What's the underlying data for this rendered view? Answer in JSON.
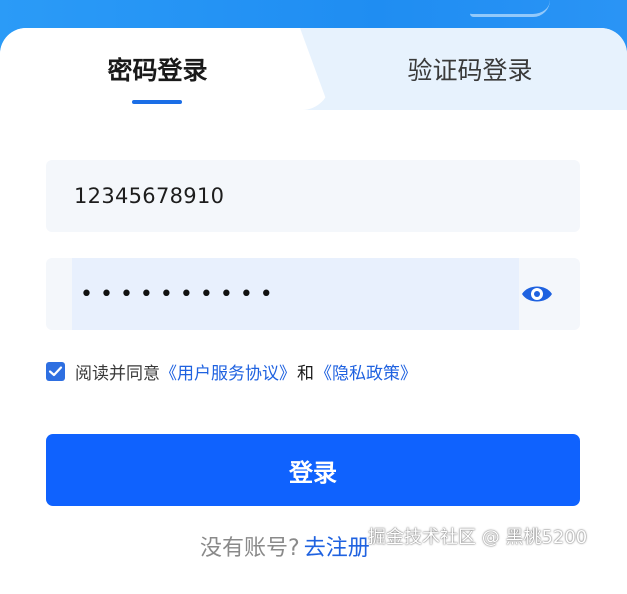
{
  "colors": {
    "primary": "#0f62fe",
    "link": "#1f62e0",
    "header_blue": "#2a8df5",
    "inactive_tab_bg": "#e7f2fd"
  },
  "tabs": [
    {
      "label": "密码登录",
      "active": true
    },
    {
      "label": "验证码登录",
      "active": false
    }
  ],
  "form": {
    "phone_value": "12345678910",
    "password_masked": "••••••••••",
    "show_password_icon": "eye-icon"
  },
  "agreement": {
    "checked": true,
    "prefix": "阅读并同意",
    "terms_link": "《用户服务协议》",
    "conjunction": "和",
    "privacy_link": "《隐私政策》"
  },
  "login_button": "登录",
  "register": {
    "prompt": "没有账号?",
    "link": "去注册"
  },
  "watermark": "掘金技术社区 @ 黑桃5200"
}
